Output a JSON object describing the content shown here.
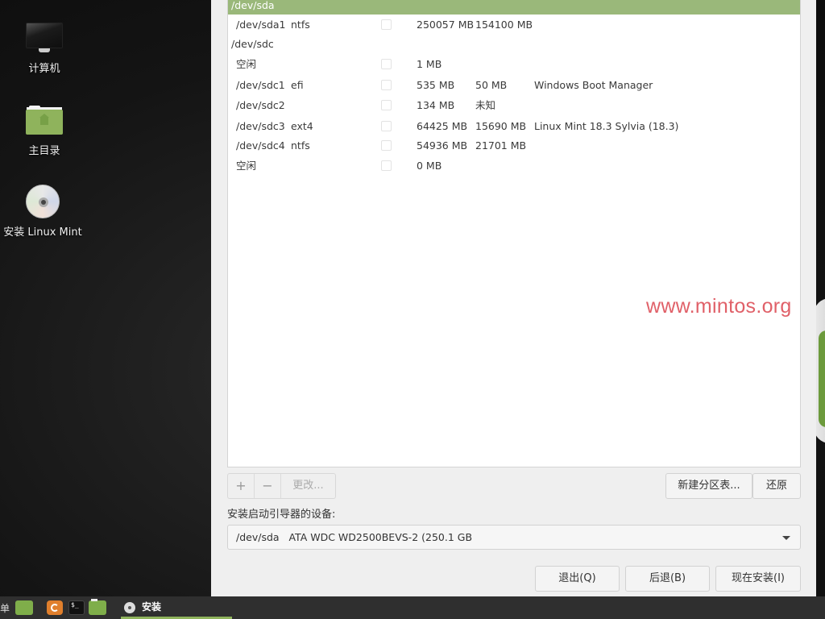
{
  "desktop": {
    "icons": [
      {
        "label": "计算机",
        "icon": "computer-icon"
      },
      {
        "label": "主目录",
        "icon": "home-folder-icon"
      },
      {
        "label": "安装 Linux Mint",
        "icon": "install-disc-icon"
      }
    ],
    "watermark": "www.mintos.org"
  },
  "installer": {
    "partitions": [
      {
        "kind": "group",
        "device": "/dev/sda",
        "selected": true
      },
      {
        "kind": "part",
        "device": "/dev/sda1",
        "type": "ntfs",
        "format": false,
        "size": "250057 MB",
        "used": "154100 MB",
        "system": ""
      },
      {
        "kind": "group",
        "device": "/dev/sdc",
        "selected": false
      },
      {
        "kind": "part",
        "device": "空闲",
        "type": "",
        "format": false,
        "size": "1 MB",
        "used": "",
        "system": ""
      },
      {
        "kind": "part",
        "device": "/dev/sdc1",
        "type": "efi",
        "format": false,
        "size": "535 MB",
        "used": "50 MB",
        "system": "Windows Boot Manager"
      },
      {
        "kind": "part",
        "device": "/dev/sdc2",
        "type": "",
        "format": false,
        "size": "134 MB",
        "used": "未知",
        "system": ""
      },
      {
        "kind": "part",
        "device": "/dev/sdc3",
        "type": "ext4",
        "format": false,
        "size": "64425 MB",
        "used": "15690 MB",
        "system": "Linux Mint 18.3 Sylvia (18.3)"
      },
      {
        "kind": "part",
        "device": "/dev/sdc4",
        "type": "ntfs",
        "format": false,
        "size": "54936 MB",
        "used": "21701 MB",
        "system": ""
      },
      {
        "kind": "part",
        "device": "空闲",
        "type": "",
        "format": false,
        "size": "0 MB",
        "used": "",
        "system": ""
      }
    ],
    "toolbar": {
      "add_label": "+",
      "remove_label": "−",
      "change_label": "更改...",
      "new_table_label": "新建分区表...",
      "revert_label": "还原"
    },
    "bootloader": {
      "label": "安装启动引导器的设备:",
      "selected": "/dev/sda   ATA WDC WD2500BEVS-2 (250.1 GB"
    },
    "actions": {
      "quit_label": "退出(Q)",
      "back_label": "后退(B)",
      "install_label": "现在安装(I)"
    }
  },
  "taskbar": {
    "menu_label": "单",
    "launchers": [
      "show-desktop",
      "firefox",
      "terminal",
      "files"
    ],
    "terminal_glyph": "$_",
    "active_task": "安装"
  },
  "colors": {
    "selection": "#9ab87a",
    "watermark": "#e06068",
    "mint_green": "#8fb35c"
  }
}
